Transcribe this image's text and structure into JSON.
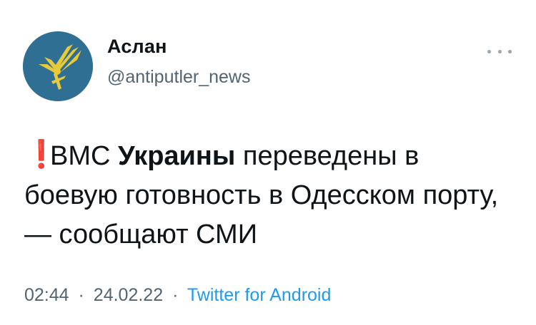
{
  "tweet": {
    "author": {
      "display_name": "Аслан",
      "handle": "@antiputler_news",
      "avatar_icon": "eagle-emblem-icon"
    },
    "more_icon": "more-dots-icon",
    "text": {
      "emoji": "❗",
      "part1": "ВМС ",
      "bold": "Украины",
      "part2": " переведены в боевую готовность в Одесском порту, — сообщают СМИ"
    },
    "meta": {
      "time": "02:44",
      "separator": "·",
      "date": "24.02.22",
      "source": "Twitter for Android"
    }
  },
  "colors": {
    "avatar_bg": "#2f6f93",
    "emblem": "#e7c93a",
    "link": "#1d9bf0",
    "muted": "#536471",
    "exclaim": "#e0282e"
  }
}
